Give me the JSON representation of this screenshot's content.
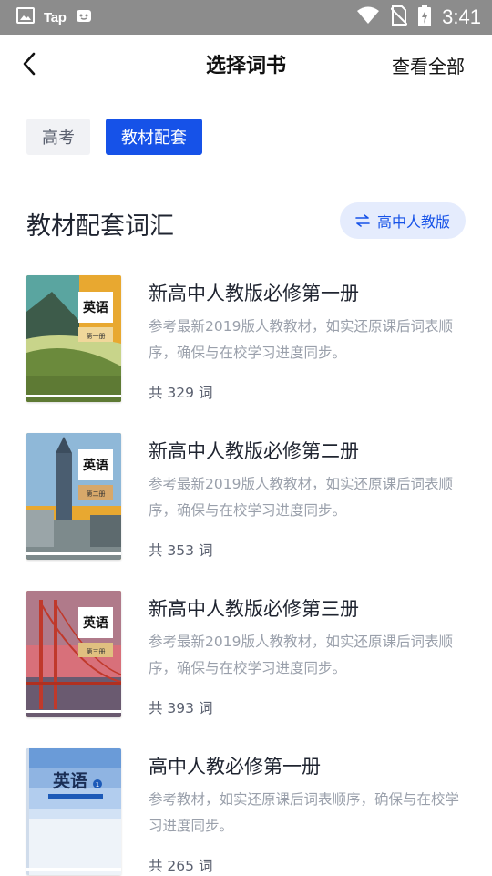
{
  "status_bar": {
    "app_label": "Tap",
    "time": "3:41",
    "icons": [
      "image-icon",
      "tap-app-icon",
      "notification-app-icon",
      "wifi-icon",
      "no-sim-icon",
      "battery-charging-icon"
    ]
  },
  "header": {
    "title": "选择词书",
    "view_all": "查看全部",
    "back_icon": "chevron-left-icon"
  },
  "tabs": [
    {
      "label": "高考",
      "active": false
    },
    {
      "label": "教材配套",
      "active": true
    }
  ],
  "section": {
    "title": "教材配套词汇",
    "filter_label": "高中人教版",
    "filter_icon": "swap-icon"
  },
  "books": [
    {
      "name": "新高中人教版必修第一册",
      "description": "参考最新2019版人教教材，如实还原课后词表顺序，确保与在校学习进度同步。",
      "count": "共 329 词",
      "cover_title": "英语",
      "cover_volume": "第一册"
    },
    {
      "name": "新高中人教版必修第二册",
      "description": "参考最新2019版人教教材，如实还原课后词表顺序，确保与在校学习进度同步。",
      "count": "共 353 词",
      "cover_title": "英语",
      "cover_volume": "第二册"
    },
    {
      "name": "新高中人教版必修第三册",
      "description": "参考最新2019版人教教材，如实还原课后词表顺序，确保与在校学习进度同步。",
      "count": "共 393 词",
      "cover_title": "英语",
      "cover_volume": "第三册"
    },
    {
      "name": "高中人教必修第一册",
      "description": "参考教材，如实还原课后词表顺序，确保与在校学习进度同步。",
      "count": "共 265 词",
      "cover_title": "英语",
      "cover_badge": "1"
    }
  ],
  "colors": {
    "accent": "#1652e8",
    "accent_light": "#e5ecfd",
    "status_bar": "#8c8c8c",
    "muted_text": "#9aa0ab"
  }
}
